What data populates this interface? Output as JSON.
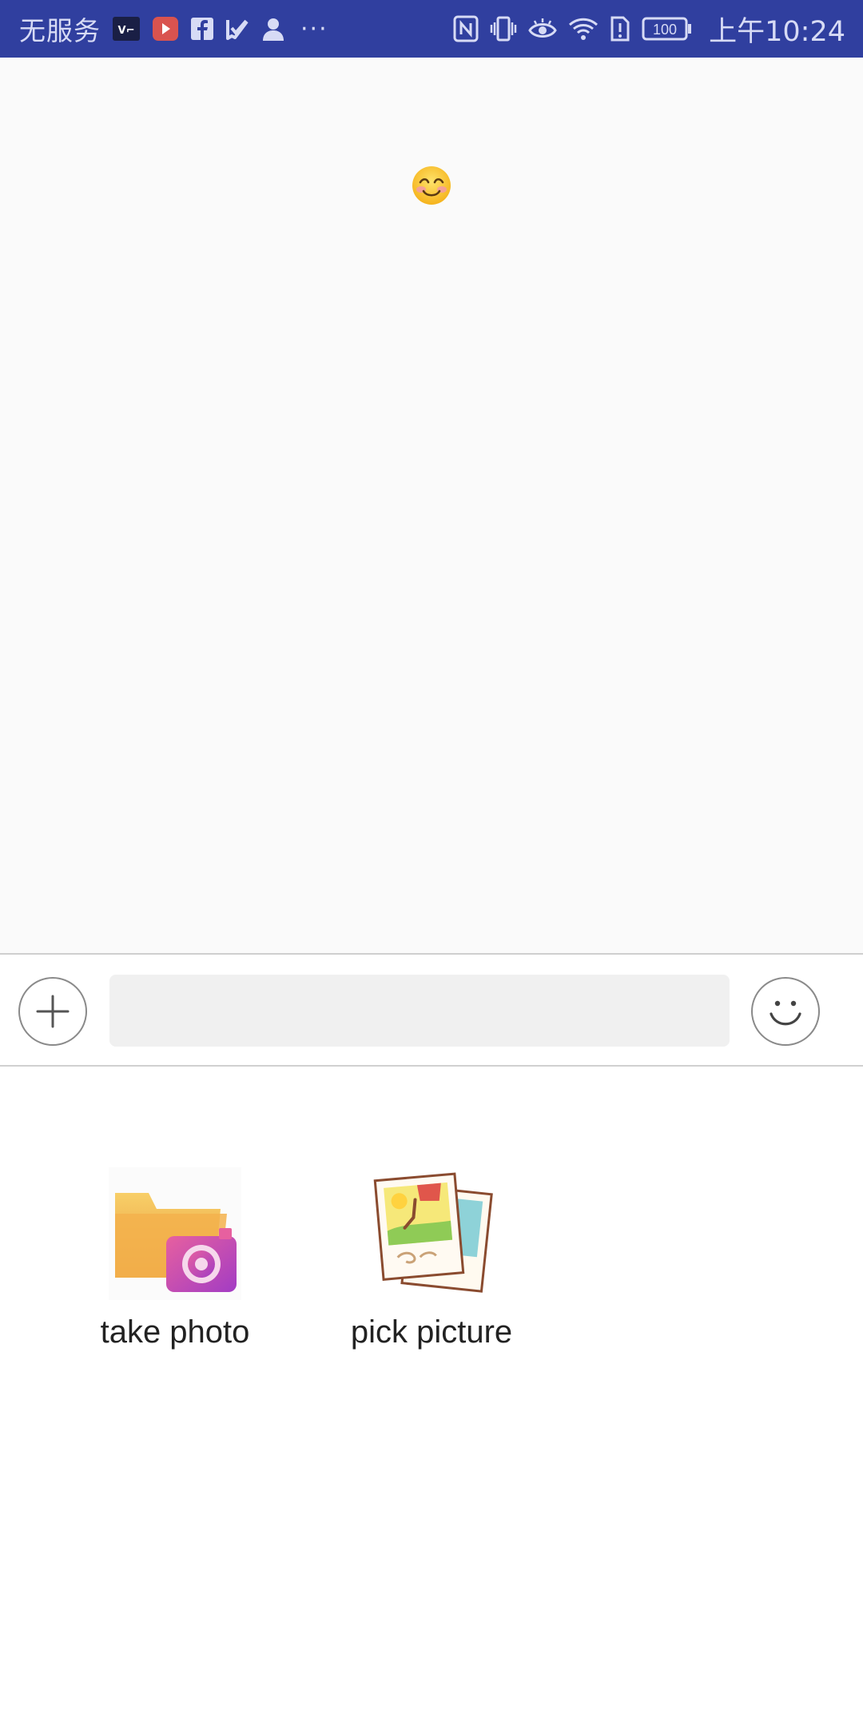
{
  "status_bar": {
    "carrier": "无服务",
    "overflow": "···",
    "battery": "100",
    "time": "上午10:24",
    "left_icons": [
      "vpn-icon",
      "video-app-icon",
      "facebook-icon",
      "check-app-icon",
      "person-icon"
    ],
    "right_icons": [
      "nfc-icon",
      "vibrate-icon",
      "eye-comfort-icon",
      "wifi-icon",
      "sim-alert-icon",
      "battery-icon"
    ]
  },
  "message_area": {
    "message_emoji": "smiling-face-emoji"
  },
  "input_bar": {
    "plus_icon": "plus-icon",
    "text_value": "",
    "text_placeholder": "",
    "emoji_icon": "smiley-icon"
  },
  "panel": {
    "items": [
      {
        "label": "take photo",
        "icon": "folder-camera-icon"
      },
      {
        "label": "pick picture",
        "icon": "photo-stack-icon"
      }
    ]
  },
  "colors": {
    "status_bar_bg": "#303F9F",
    "message_bg": "#fafafa",
    "input_bg": "#f0f0f0"
  }
}
